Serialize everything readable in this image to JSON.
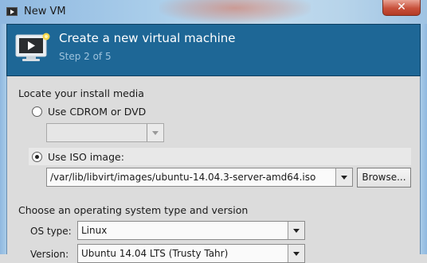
{
  "window": {
    "title": "New VM",
    "close_symbol": "✕"
  },
  "header": {
    "title": "Create a new virtual machine",
    "step": "Step 2 of 5"
  },
  "install_media": {
    "section_title": "Locate your install media",
    "cdrom_label": "Use CDROM or DVD",
    "cdrom_selected": "",
    "iso_label": "Use ISO image:",
    "iso_path": "/var/lib/libvirt/images/ubuntu-14.04.3-server-amd64.iso",
    "browse_label": "Browse..."
  },
  "os": {
    "section_title": "Choose an operating system type and version",
    "type_label": "OS type:",
    "type_value": "Linux",
    "version_label": "Version:",
    "version_value": "Ubuntu 14.04 LTS (Trusty Tahr)"
  },
  "colors": {
    "header_bg": "#1e6796",
    "step_text": "#9ec3dd",
    "close_button": "#c8503b"
  }
}
